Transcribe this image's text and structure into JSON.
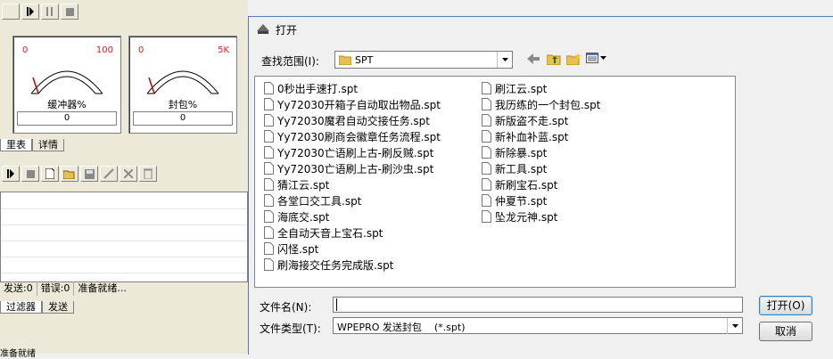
{
  "app": {
    "meters": [
      {
        "min": "0",
        "max": "100",
        "label": "缓冲器%",
        "value": "0",
        "needle": 0
      },
      {
        "min": "0",
        "max": "5K",
        "label": "封包%",
        "value": "0",
        "needle": 0
      }
    ],
    "tabs_top": [
      "里表",
      "详情"
    ],
    "tabs_bottom": [
      "过滤器",
      "发送"
    ],
    "status": {
      "sent": "发送:0",
      "errors": "错误:0",
      "ready": "准备就绪..."
    },
    "bottom_status": "准备就绪"
  },
  "dialog": {
    "title": "打开",
    "lookin_label": "查找范围(I):",
    "lookin_value": "SPT",
    "files_col1": [
      "0秒出手速打.spt",
      "Yy72030开箱子自动取出物品.spt",
      "Yy72030魔君自动交接任务.spt",
      "Yy72030刷商会徽章任务流程.spt",
      "Yy72030亡语刷上古-刷反贼.spt",
      "Yy72030亡语刷上古-刷沙虫.spt",
      "猜江云.spt",
      "各堂口交工具.spt",
      "海底交.spt",
      "全自动天音上宝石.spt",
      "闪怪.spt",
      "刷海接交任务完成版.spt"
    ],
    "files_col2": [
      "刷江云.spt",
      "我历练的一个封包.spt",
      "新版盗不走.spt",
      "新补血补蓝.spt",
      "新除暴.spt",
      "新工具.spt",
      "新刷宝石.spt",
      "仲夏节.spt",
      "坠龙元神.spt"
    ],
    "filename_label": "文件名(N):",
    "filename_value": "",
    "filetype_label": "文件类型(T):",
    "filetype_value": "WPEPRO 发送封包    (*.spt)",
    "open_button": "打开(O)",
    "cancel_button": "取消"
  }
}
